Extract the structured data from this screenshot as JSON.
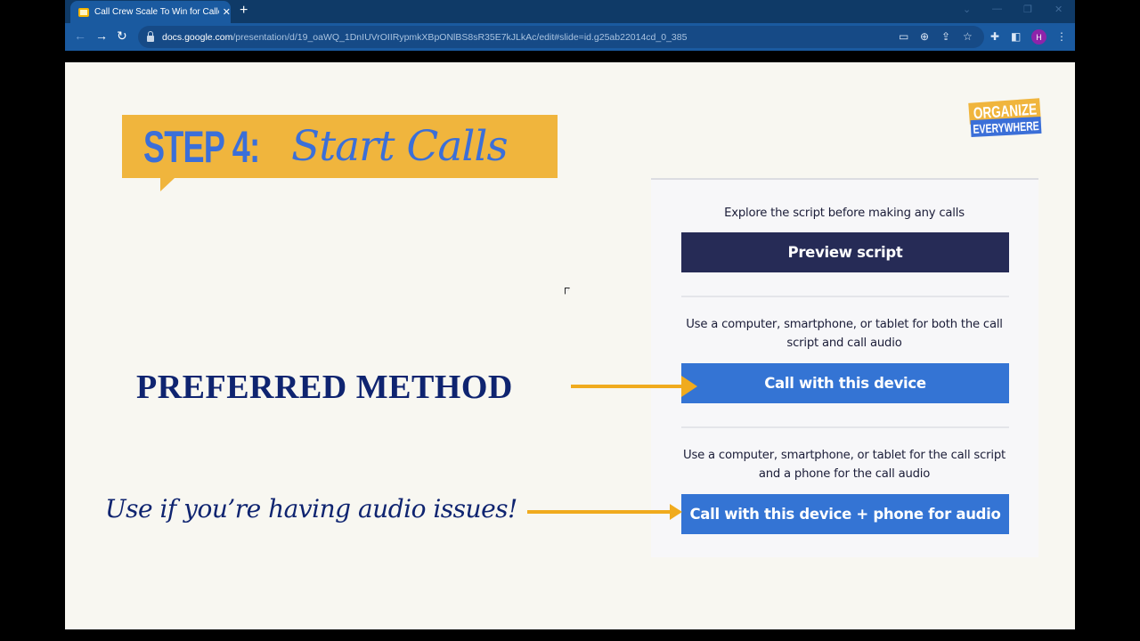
{
  "browser": {
    "tab": {
      "title": "Call Crew Scale To Win for Callers",
      "favicon": "google-slides-icon",
      "close_glyph": "✕"
    },
    "new_tab_glyph": "+",
    "window_controls": {
      "dropdown": "⌄",
      "minimize": "—",
      "restore": "❐",
      "close": "✕"
    },
    "nav": {
      "back": "←",
      "forward": "→",
      "reload": "↻"
    },
    "url": {
      "host": "docs.google.com",
      "path": "/presentation/d/19_oaWQ_1DnIUVrOIIRypmkXBpONlBS8sR35E7kJLkAc/edit#slide=id.g25ab22014cd_0_385"
    },
    "toolbar_icons": {
      "cast": "▭",
      "zoom": "⊕",
      "share": "⇪",
      "bookmark": "☆",
      "extensions": "✚",
      "side_panel": "◧",
      "menu": "⋮"
    },
    "profile_initial": "H"
  },
  "slide": {
    "banner": {
      "step": "STEP 4:",
      "title": "Start Calls"
    },
    "logo": {
      "line1": "ORGANIZE",
      "line2": "EVERYWHERE"
    },
    "labels": {
      "preferred": "PREFERRED METHOD",
      "audio_issues": "Use if you’re having audio issues!"
    },
    "panel": {
      "sections": [
        {
          "description": "Explore the script before making any calls",
          "button": "Preview script"
        },
        {
          "description": "Use a computer, smartphone, or tablet for both the call script and call audio",
          "button": "Call with this device"
        },
        {
          "description": "Use a computer, smartphone, or tablet for the call script and a phone for the call audio",
          "button": "Call with this device + phone for audio"
        }
      ]
    }
  },
  "colors": {
    "banner_yellow": "#f0b53d",
    "accent_blue": "#3b6fd8",
    "button_dark": "#262b56",
    "button_blue": "#3474d4",
    "navy_text": "#0f2470",
    "arrow_orange": "#f0ab1e"
  }
}
